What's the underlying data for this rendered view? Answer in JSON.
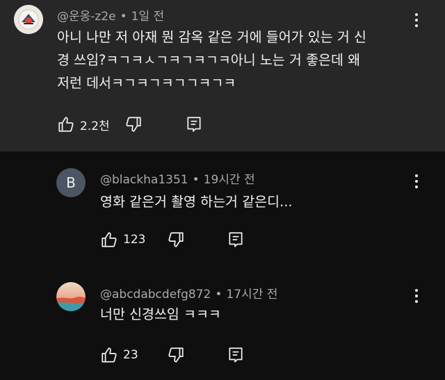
{
  "comments": [
    {
      "author": "@운옹-z2e",
      "time": "1일 전",
      "text_lines": [
        "아니 나만 저 아재 뭔 감옥 같은 거에 들어가 있는 거 신",
        "경 쓰임?ㅋㄱㅋㅅㄱㅋㄱㅋㄱㅋ아니 노는 거 좋은데 왜",
        "저런 데서ㅋㄱㅋㄱㅋㄱㄱㅋㄱㅋ"
      ],
      "likes": "2.2천"
    },
    {
      "author": "@blackha1351",
      "time": "19시간 전",
      "avatar_letter": "B",
      "text_lines": [
        "영화 같은거 촬영 하는거 같은디..."
      ],
      "likes": "123"
    },
    {
      "author": "@abcdabcdefg872",
      "time": "17시간 전",
      "text_lines": [
        "너만 신경쓰임 ㅋㅋㅋ"
      ],
      "likes": "23"
    }
  ],
  "separator": "•",
  "icons": [
    "like-icon",
    "dislike-icon",
    "reply-icon",
    "more-options-icon"
  ],
  "colors": {
    "top_bg": "#272727",
    "page_bg": "#0f0f0f",
    "meta": "#aaaaaa",
    "text": "#f1f1f1",
    "avatar_b": "#4c5563"
  }
}
